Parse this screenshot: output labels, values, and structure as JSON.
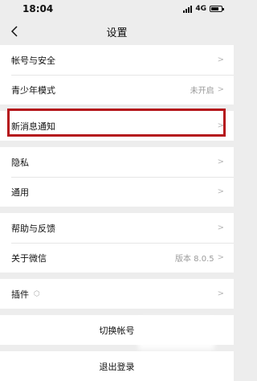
{
  "status": {
    "time": "18:04",
    "network": "4G"
  },
  "nav": {
    "title": "设置"
  },
  "sections": [
    [
      {
        "label": "帐号与安全",
        "value": ""
      },
      {
        "label": "青少年模式",
        "value": "未开启"
      }
    ],
    [
      {
        "label": "新消息通知",
        "value": ""
      }
    ],
    [
      {
        "label": "隐私",
        "value": ""
      },
      {
        "label": "通用",
        "value": ""
      }
    ],
    [
      {
        "label": "帮助与反馈",
        "value": ""
      },
      {
        "label": "关于微信",
        "value": "版本 8.0.5"
      }
    ],
    [
      {
        "label": "插件",
        "value": ""
      }
    ]
  ],
  "buttons": {
    "switch_account": "切换帐号",
    "logout": "退出登录"
  },
  "colors": {
    "highlight": "#b5151b",
    "background": "#ededed"
  },
  "icons": {
    "back": "chevron-left-icon",
    "chevron": "chevron-right-icon",
    "plugin": "plugin-icon"
  }
}
